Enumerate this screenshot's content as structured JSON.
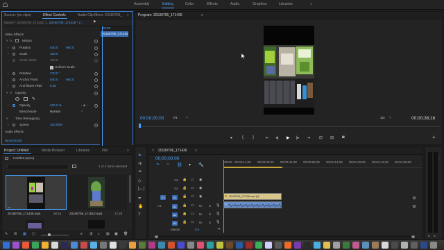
{
  "workspaces": [
    "Assembly",
    "Editing",
    "Color",
    "Effects",
    "Audio",
    "Graphics",
    "Libraries"
  ],
  "workspace_more": "»",
  "source_panel": {
    "tabs": [
      "Source: (no clips)",
      "Effect Controls",
      "Audio Clip Mixer: 20190706_"
    ],
    "tab_more": "»",
    "clip_header": "Master * 20190706_171436_1...",
    "clip_header2": "20190706_171436 * 2...",
    "mini_timecode": "00:00",
    "mini_clip": "20190706_171436",
    "section_video": "Video Effects",
    "motion": "Motion",
    "position_label": "Position",
    "position_x": "540.0",
    "position_y": "960.0",
    "scale_label": "Scale",
    "scale_val": "100.0",
    "scale_width_label": "Scale Width",
    "scale_width_val": "100.0",
    "uniform_scale": "Uniform Scale",
    "rotation_label": "Rotation",
    "rotation_val": "270.0 °",
    "anchor_label": "Anchor Point",
    "anchor_x": "540.0",
    "anchor_y": "960.0",
    "antiflicker_label": "Anti-flicker Filter",
    "antiflicker_val": "0.00",
    "opacity": "Opacity",
    "opacity_label": "Opacity",
    "opacity_val": "100.0 %",
    "blend_label": "Blend Mode",
    "blend_val": "Normal",
    "time_remap": "Time Remapping",
    "speed_label": "Speed",
    "speed_val": "100.00%",
    "section_audio": "Audio Effects",
    "footer_timecode": "00;00;00;00"
  },
  "program": {
    "title": "Program: 20190706_171436",
    "title_more": "≡",
    "timecode": "00;00;00;00",
    "fit": "Fit",
    "resolution": "1/2",
    "duration": "00;00;38;16"
  },
  "project_panel": {
    "tabs": [
      "Project: Untitled",
      "Media Browser",
      "Libraries",
      "Info"
    ],
    "tab_more": "»",
    "project_file": "Untitled.prproj",
    "items_selected": "1 of 4 items selected",
    "items": [
      {
        "name": "20190706_171436.mp4",
        "duration": "38;16"
      },
      {
        "name": "20190706_171810.mp4",
        "duration": "17;28"
      }
    ]
  },
  "timeline": {
    "sequence_tab": "20190706_171436",
    "sequence_tab_close": "×",
    "sequence_more": "≡",
    "timecode": "00;00;00;00",
    "ruler": [
      ";00;00",
      "00;00;14;29",
      "00;00;29;29",
      "00;00;44;28",
      "00;00;59;28",
      "00;01;14;29",
      "00;01;29;29",
      "00;01;44;28",
      "00;01;59;28"
    ],
    "tracks_video": [
      "V3",
      "V2",
      "V1"
    ],
    "tracks_audio": [
      "A1",
      "A2",
      "A3"
    ],
    "master_label": "Master",
    "master_val": "0.0",
    "video_clip": "20190706_171436.mp4 [V]",
    "audio_clip_label": "fx"
  },
  "colors": {
    "accent": "#4aa3ff",
    "video_clip": "#d7c58a",
    "audio_clip": "#6a8fc7"
  }
}
